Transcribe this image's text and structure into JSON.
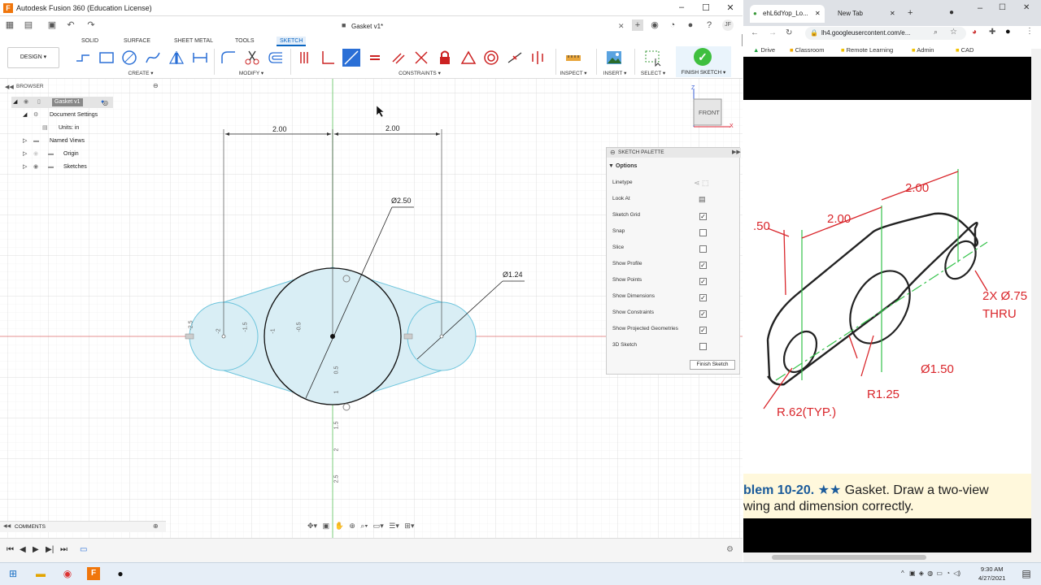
{
  "fusion": {
    "title": "Autodesk Fusion 360 (Education License)",
    "doc_tab": "Gasket v1*",
    "user_initials": "JF",
    "workspace": "DESIGN ▾",
    "ribbon_tabs": [
      "SOLID",
      "SURFACE",
      "SHEET METAL",
      "TOOLS",
      "SKETCH"
    ],
    "groups": {
      "create": "CREATE ▾",
      "modify": "MODIFY ▾",
      "constraints": "CONSTRAINTS ▾",
      "inspect": "INSPECT ▾",
      "insert": "INSERT ▾",
      "select": "SELECT ▾",
      "finish": "FINISH SKETCH ▾"
    },
    "browser": {
      "header": "BROWSER",
      "root": "Gasket v1",
      "doc_settings": "Document Settings",
      "units": "Units: in",
      "named_views": "Named Views",
      "origin": "Origin",
      "sketches": "Sketches"
    },
    "viewcube": {
      "face": "FRONT",
      "z": "Z",
      "x": "X"
    },
    "sketch": {
      "dim_left": "2.00",
      "dim_right": "2.00",
      "dia_big": "Ø2.50",
      "dia_small": "Ø1.24",
      "ruler_h": [
        "-2.5",
        "-2",
        "-1.5",
        "-1",
        "-0.5"
      ],
      "ruler_v": [
        "0.5",
        "1",
        "1.5",
        "2",
        "2.5"
      ]
    },
    "palette": {
      "header": "SKETCH PALETTE",
      "section": "Options",
      "rows": [
        {
          "label": "Linetype",
          "mark": ""
        },
        {
          "label": "Look At",
          "mark": ""
        },
        {
          "label": "Sketch Grid",
          "mark": "✓"
        },
        {
          "label": "Snap",
          "mark": ""
        },
        {
          "label": "Slice",
          "mark": ""
        },
        {
          "label": "Show Profile",
          "mark": "✓"
        },
        {
          "label": "Show Points",
          "mark": "✓"
        },
        {
          "label": "Show Dimensions",
          "mark": "✓"
        },
        {
          "label": "Show Constraints",
          "mark": "✓"
        },
        {
          "label": "Show Projected Geometries",
          "mark": "✓"
        },
        {
          "label": "3D Sketch",
          "mark": ""
        }
      ],
      "finish_button": "Finish Sketch"
    },
    "comments": "COMMENTS"
  },
  "chrome": {
    "tab_active": "ehL6dYop_Lo...",
    "tab_new": "New Tab",
    "url": "lh4.googleusercontent.com/e...",
    "bookmarks": [
      "Drive",
      "Classroom",
      "Remote Learning",
      "Admin",
      "CAD"
    ],
    "figure": {
      "dim1": ".50",
      "dim2": "2.00",
      "dim3": "2.00",
      "holes": "2X Ø.75",
      "thru": "THRU",
      "dia_center": "Ø1.50",
      "r_big": "R1.25",
      "r_small": "R.62(TYP.)",
      "page_digit": "2"
    },
    "caption_bold": "blem 10-20.",
    "caption_stars": "★★",
    "caption_rest": "Gasket. Draw a two-view",
    "caption_line2": "wing and dimension correctly."
  },
  "taskbar": {
    "time": "9:30 AM",
    "date": "4/27/2021"
  },
  "colors": {
    "accent": "#0a66c2",
    "profile_fill": "#d9eef5",
    "profile_stroke": "#6cc4dc",
    "axis_green": "#4fc24f",
    "axis_red": "#e05a5a",
    "figure_green": "#34c24a",
    "figure_red": "#d9262b"
  }
}
